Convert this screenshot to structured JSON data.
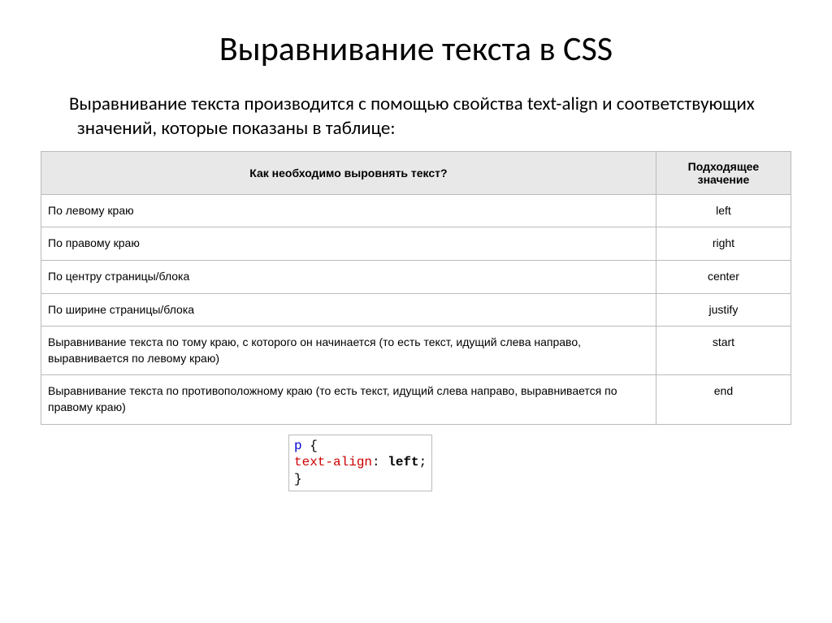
{
  "title": "Выравнивание текста в CSS",
  "description": "Выравнивание текста производится с помощью свойства text-align и соответствующих значений, которые показаны в таблице:",
  "table": {
    "header1": "Как необходимо выровнять текст?",
    "header2": "Подходящее значение",
    "rows": [
      {
        "desc": "По левому краю",
        "val": "left"
      },
      {
        "desc": "По правому краю",
        "val": "right"
      },
      {
        "desc": "По центру страницы/блока",
        "val": "center"
      },
      {
        "desc": "По ширине страницы/блока",
        "val": "justify"
      },
      {
        "desc": "Выравнивание текста по тому краю, с которого он начинается (то есть текст, идущий слева направо, выравнивается по левому краю)",
        "val": "start"
      },
      {
        "desc": "Выравнивание текста по противоположному краю (то есть текст, идущий слева направо, выравнивается по правому краю)",
        "val": "end"
      }
    ]
  },
  "code": {
    "selector": "p",
    "brace_open": " {",
    "property": "text-align",
    "colon": ": ",
    "value": "left",
    "semicolon": ";",
    "brace_close": "}"
  }
}
